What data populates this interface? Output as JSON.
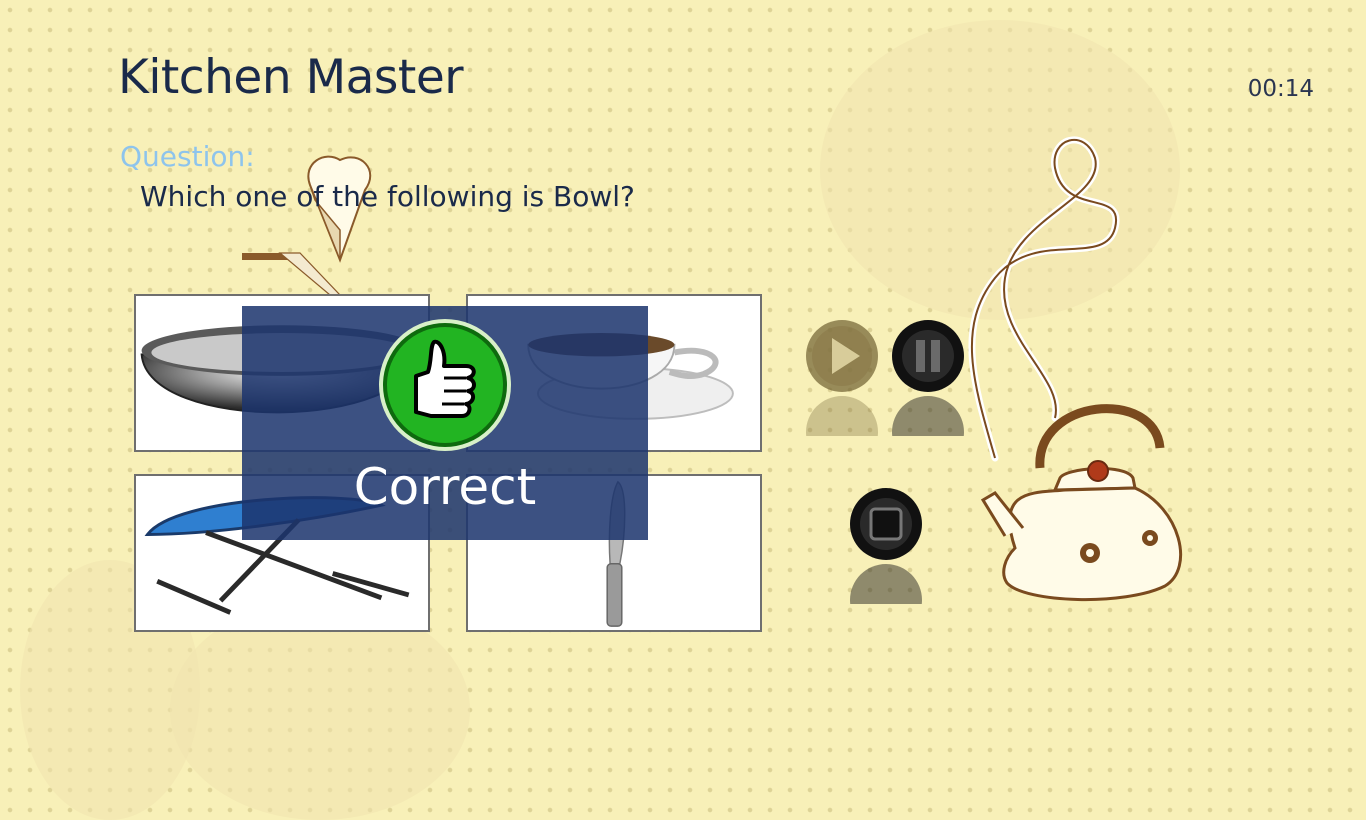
{
  "app": {
    "title": "Kitchen Master",
    "timer": "00:14"
  },
  "question": {
    "label": "Question:",
    "text": "Which one of the following is Bowl?"
  },
  "options": [
    {
      "name": "bowl",
      "icon": "bowl-image"
    },
    {
      "name": "cup",
      "icon": "teacup-image"
    },
    {
      "name": "ironing-board",
      "icon": "ironing-board-image"
    },
    {
      "name": "knife",
      "icon": "knife-image"
    }
  ],
  "controls": {
    "play": "play-icon",
    "pause": "pause-icon",
    "stop": "stop-icon"
  },
  "result": {
    "text": "Correct",
    "icon": "thumbs-up-icon"
  },
  "colors": {
    "background": "#f8f0b8",
    "title": "#1a2a4a",
    "question_label": "#8ec4ec",
    "overlay": "#1c346e",
    "correct_badge": "#22b422"
  }
}
